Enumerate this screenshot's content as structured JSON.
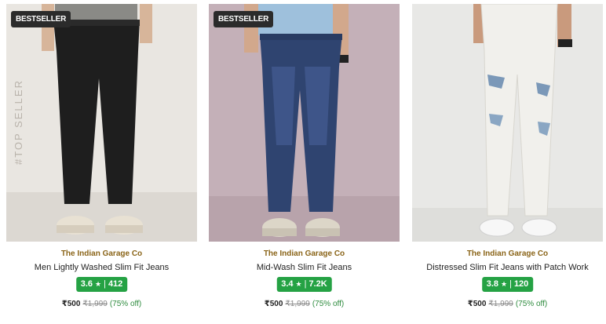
{
  "products": [
    {
      "badge": "BESTSELLER",
      "watermark": "#TOP SELLER",
      "brand": "The Indian Garage Co",
      "name": "Men Lightly Washed Slim Fit Jeans",
      "rating": "3.6",
      "rating_count": "412",
      "price": "₹500",
      "mrp": "₹1,999",
      "discount": "(75% off)",
      "jean_color": "#1e1e1e",
      "background_color": "#e9e6e1"
    },
    {
      "badge": "BESTSELLER",
      "brand": "The Indian Garage Co",
      "name": "Mid-Wash Slim Fit Jeans",
      "rating": "3.4",
      "rating_count": "7.2K",
      "price": "₹500",
      "mrp": "₹1,999",
      "discount": "(75% off)",
      "jean_color": "#2f4470",
      "background_color": "#c4b0b8"
    },
    {
      "brand": "The Indian Garage Co",
      "name": "Distressed Slim Fit Jeans with Patch Work",
      "rating": "3.8",
      "rating_count": "120",
      "price": "₹500",
      "mrp": "₹1,999",
      "discount": "(75% off)",
      "jean_color": "#f1f0ec",
      "background_color": "#e8e8e6"
    }
  ],
  "icons": {
    "star": "star-icon"
  },
  "colors": {
    "rating_bg": "#25a244",
    "brand": "#8a6418",
    "badge_bg": "#2b2b2b"
  }
}
